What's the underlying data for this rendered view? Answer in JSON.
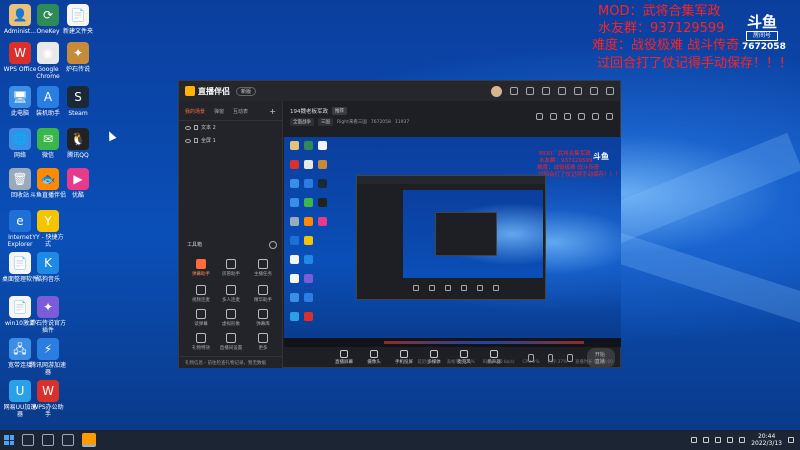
{
  "overlay": {
    "line1": "MOD：武将合集军政",
    "line2": "水友群：937129599",
    "line3": "难度：战役极难 战斗传奇",
    "line4": "过回合打了仗记得手动保存！！！",
    "badge_logo": "斗鱼",
    "badge_sub": "房间号",
    "badge_room": "7672058"
  },
  "desktop_icons": [
    {
      "label": "Administ...",
      "glyph": "👤",
      "color": "#e8c27a"
    },
    {
      "label": "OneKey",
      "glyph": "⟳",
      "color": "#2e8b57"
    },
    {
      "label": "新建文件夹",
      "glyph": "📄",
      "color": "#f5f5f5"
    },
    {
      "label": "WPS Office",
      "glyph": "W",
      "color": "#d9302c"
    },
    {
      "label": "Google Chrome",
      "glyph": "◉",
      "color": "#e8e8e8"
    },
    {
      "label": "炉石传说",
      "glyph": "✦",
      "color": "#c58a3a"
    },
    {
      "label": "此电脑",
      "glyph": "🖥",
      "color": "#3a8ee6"
    },
    {
      "label": "装机助手",
      "glyph": "A",
      "color": "#2a7de1"
    },
    {
      "label": "Steam",
      "glyph": "S",
      "color": "#1b2838"
    },
    {
      "label": "网络",
      "glyph": "🌐",
      "color": "#3a8ee6"
    },
    {
      "label": "微信",
      "glyph": "✉",
      "color": "#3bb64a"
    },
    {
      "label": "腾讯QQ",
      "glyph": "🐧",
      "color": "#222"
    },
    {
      "label": "回收站",
      "glyph": "🗑",
      "color": "#9ab"
    },
    {
      "label": "斗鱼直播伴侣",
      "glyph": "🐟",
      "color": "#ff8a00"
    },
    {
      "label": "优酷",
      "glyph": "▶",
      "color": "#e83a8c"
    },
    {
      "label": "Internet Explorer",
      "glyph": "e",
      "color": "#1f6fd8"
    },
    {
      "label": "YY - 快捷方式",
      "glyph": "Y",
      "color": "#f5c400"
    },
    {
      "label": "桌面整理软件",
      "glyph": "📄",
      "color": "#f5f5f5"
    },
    {
      "label": "酷狗音乐",
      "glyph": "K",
      "color": "#1f8ae6"
    },
    {
      "label": "win10激活",
      "glyph": "📄",
      "color": "#f5f5f5"
    },
    {
      "label": "炉石传说官方插件",
      "glyph": "✦",
      "color": "#7a5bd8"
    },
    {
      "label": "宽带连接",
      "glyph": "🖧",
      "color": "#3a8ee6"
    },
    {
      "label": "腾讯网游加速器",
      "glyph": "⚡",
      "color": "#2a7de1"
    },
    {
      "label": "网易UU加速器",
      "glyph": "U",
      "color": "#2aa0e8"
    },
    {
      "label": "WPS办公助手",
      "glyph": "W",
      "color": "#d9302c"
    }
  ],
  "app": {
    "brand": "直播伴侣",
    "version": "新版",
    "tabs": [
      "我的场景",
      "弹窗",
      "互动表"
    ],
    "add_label": "+",
    "scenes": [
      "文本 2",
      "全屏 1"
    ],
    "toolbox_title": "工具箱",
    "tools": [
      "弹幕助手",
      "房管助手",
      "主播任务",
      "视频连麦",
      "多人连麦",
      "精华助手",
      "读弹幕",
      "虚拟形象",
      "弹幕库",
      "礼物特效",
      "直播间设置",
      "更多"
    ],
    "footer_text": "礼物信息 - 前往检查礼物记录，暂无数据",
    "room_title": "194魏老板军政",
    "room_tag": "推荐",
    "meta_tag1": "全面战争",
    "meta_tag2": "三国",
    "meta_text": "Right来看三国",
    "meta_room": "7672058",
    "meta_hot": "11937",
    "controls": [
      "直播屏幕",
      "摄像头",
      "手机投屏",
      "多媒体",
      "麦克风",
      "扬声器"
    ],
    "start_live": "开始直播",
    "status": [
      "延迟(0ms)",
      "丢帧率:0.00%",
      "码率(0.00 kb/s)",
      "CPU:2%",
      "内存:37%",
      "直播时长 00:00:00"
    ]
  },
  "preview_overlay": {
    "l1": "MOD：武将合集军政",
    "l2": "水友群：937129599",
    "l3": "难度：战役极难 战斗传奇",
    "l4": "过回合打了仗记得手动保存！！！",
    "logo": "斗鱼"
  },
  "taskbar": {
    "time": "20:44",
    "date": "2022/3/13"
  }
}
